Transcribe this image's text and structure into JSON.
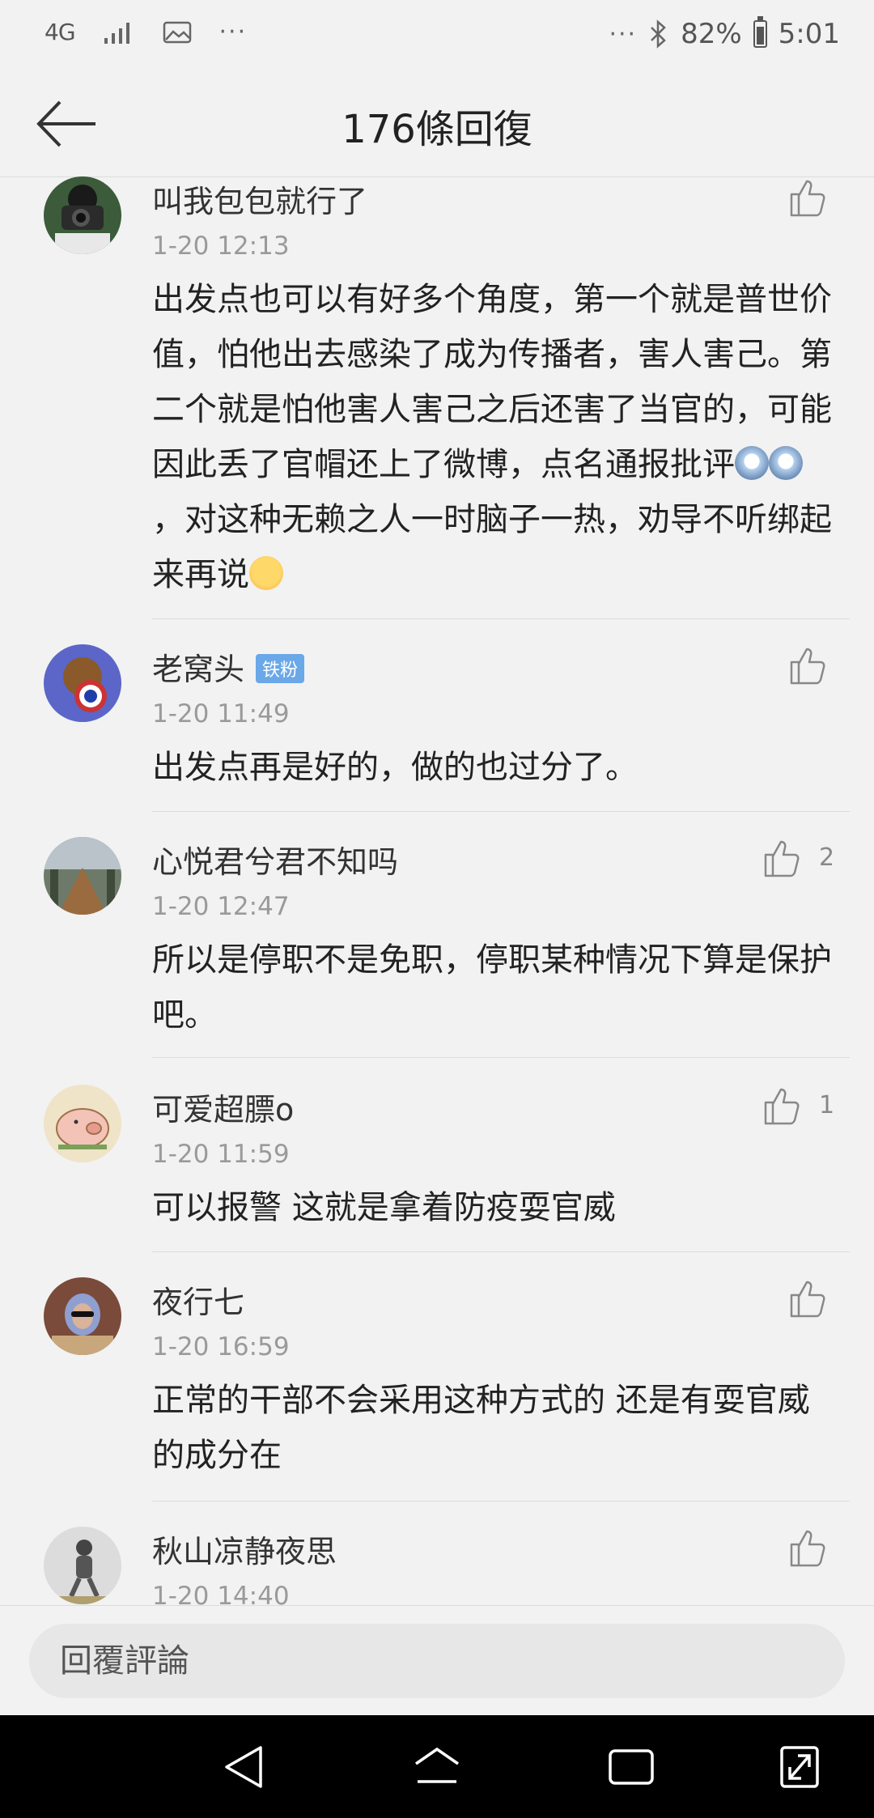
{
  "status_bar": {
    "network": "4G",
    "more": "···",
    "more_right": "···",
    "battery": "82%",
    "time": "5:01"
  },
  "header": {
    "title": "176條回復"
  },
  "comments": [
    {
      "user": "叫我包包就行了",
      "badge": "",
      "time": "1-20 12:13",
      "likes": "",
      "text_before": "出发点也可以有好多个角度，第一个就是普世价值，怕他出去感染了成为传播者，害人害己。第二个就是怕他害人害己之后还害了当官的，可能因此丢了官帽还上了微博，点名通报批评",
      "text_after": "，对这种无赖之人一时脑子一热，劝导不听绑起来再说"
    },
    {
      "user": "老窝头",
      "badge": "铁粉",
      "time": "1-20 11:49",
      "likes": "",
      "text": "出发点再是好的，做的也过分了。"
    },
    {
      "user": "心悦君兮君不知吗",
      "badge": "",
      "time": "1-20 12:47",
      "likes": "2",
      "text": "所以是停职不是免职，停职某种情况下算是保护吧。"
    },
    {
      "user": "可爱超膘o",
      "badge": "",
      "time": "1-20 11:59",
      "likes": "1",
      "text": "可以报警 这就是拿着防疫耍官威"
    },
    {
      "user": "夜行七",
      "badge": "",
      "time": "1-20 16:59",
      "likes": "",
      "text": "正常的干部不会采用这种方式的 还是有耍官威的成分在"
    },
    {
      "user": "秋山凉静夜思",
      "badge": "",
      "time": "1-20 14:40",
      "likes": "",
      "text": ""
    }
  ],
  "reply_bar": {
    "placeholder": "回覆評論"
  },
  "colors": {
    "background": "#f2f2f2",
    "badge": "#6aa8e8",
    "nav_bar": "#000000"
  }
}
